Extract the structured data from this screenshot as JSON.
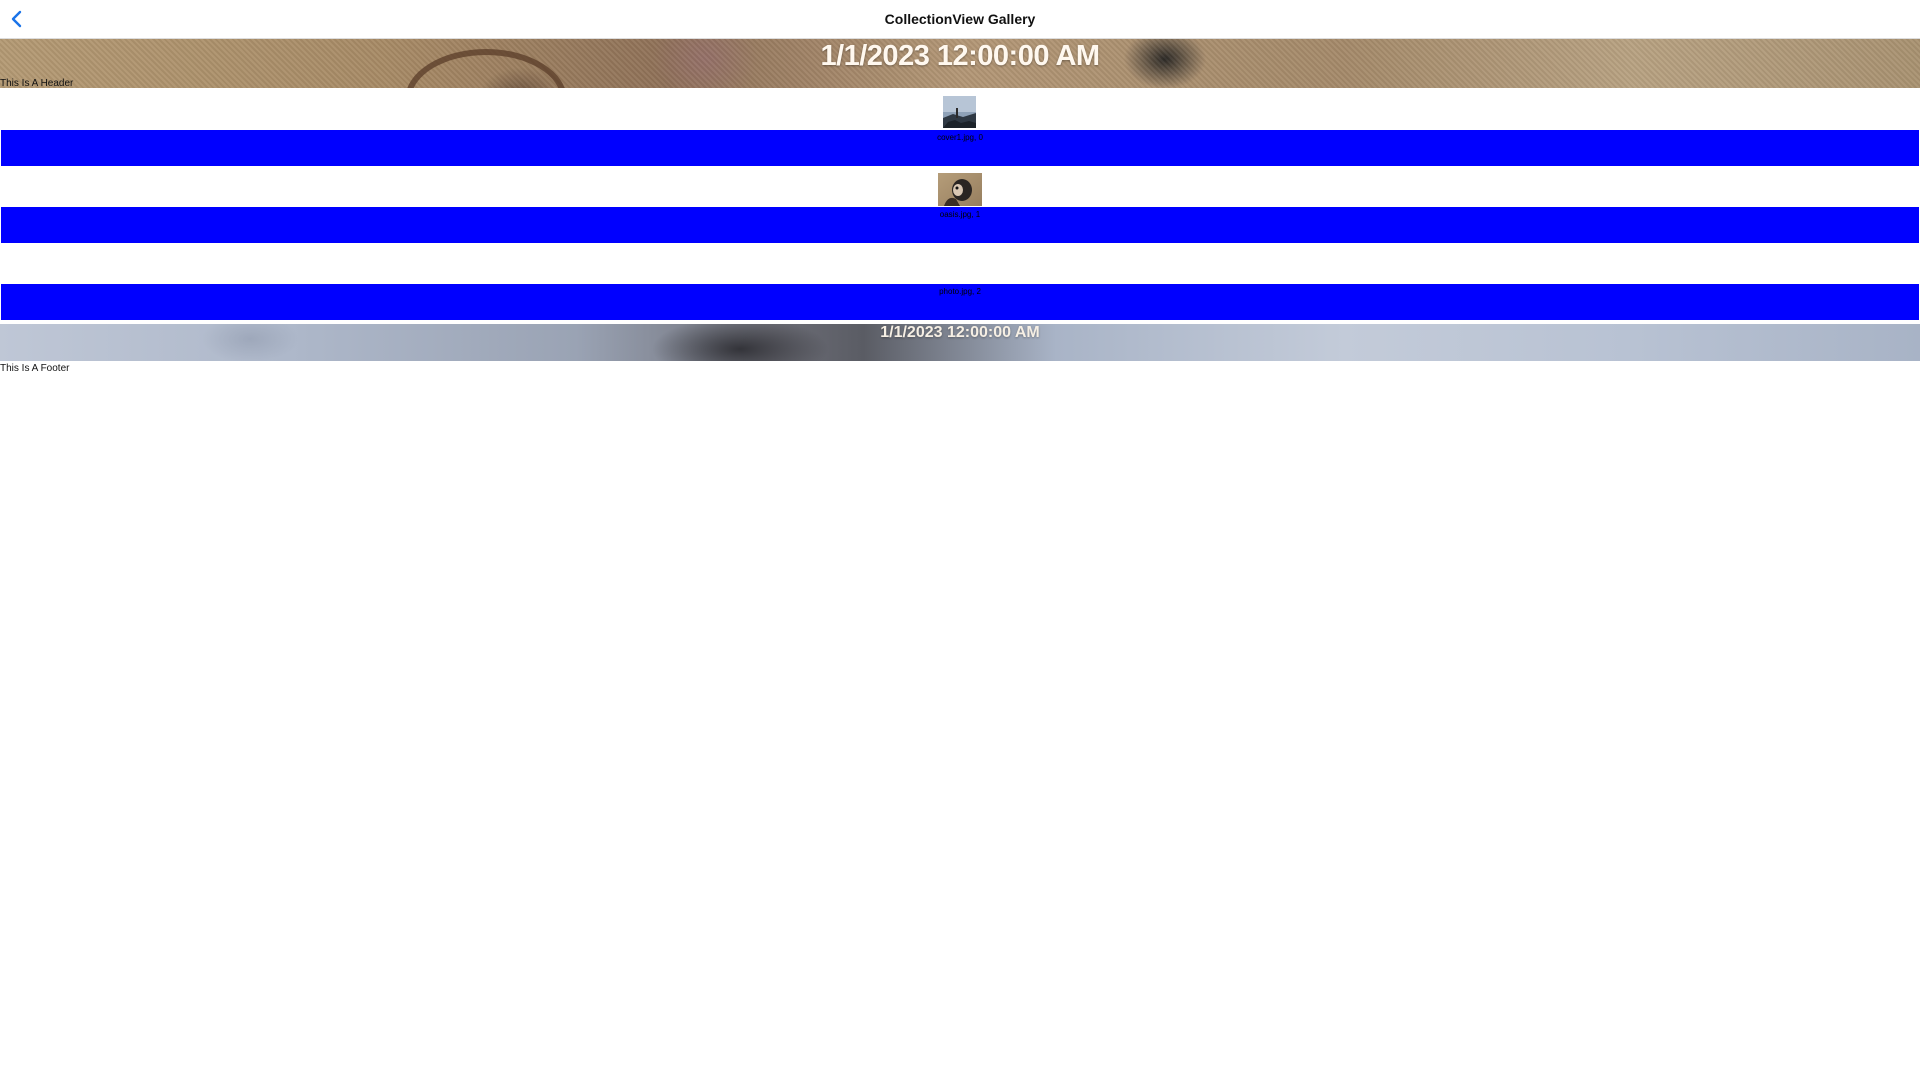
{
  "navigation": {
    "title": "CollectionView Gallery",
    "back_icon": "chevron-left-icon",
    "accent_color": "#1a73e8"
  },
  "header": {
    "date_text": "1/1/2023 12:00:00 AM",
    "label": "This Is A Header"
  },
  "items": [
    {
      "caption": "cover1.jpg, 0",
      "thumbnail": "landscape-thumbnail"
    },
    {
      "caption": "oasis.jpg, 1",
      "thumbnail": "dog-photo-thumbnail"
    },
    {
      "caption": "photo.jpg, 2",
      "thumbnail": ""
    }
  ],
  "footer": {
    "date_text": "1/1/2023 12:00:00 AM",
    "label": "This Is A Footer"
  },
  "colors": {
    "item_band": "#0000ff",
    "background": "#ffffff"
  }
}
